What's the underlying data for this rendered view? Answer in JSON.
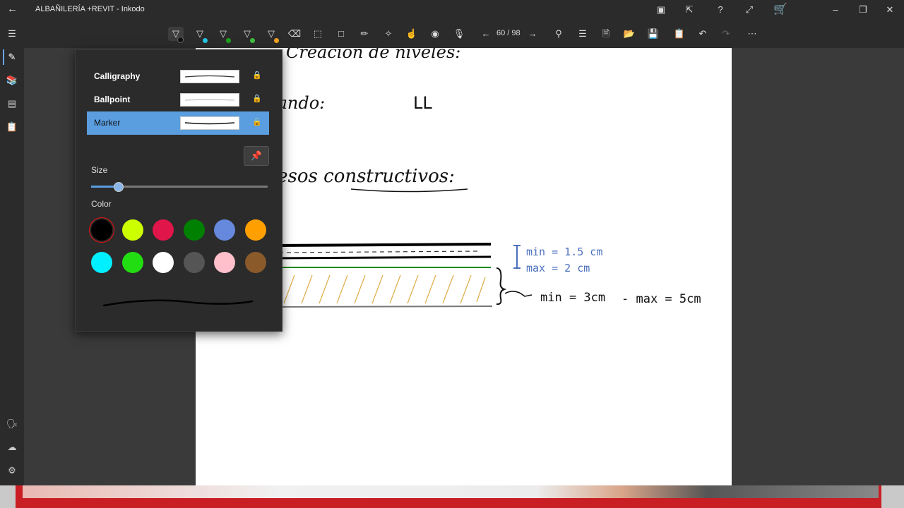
{
  "app": {
    "title": "ALBAÑILERÍA +REVIT - Inkodo"
  },
  "titlebar": {
    "icons": [
      "back-arrow-icon",
      "share-icon",
      "export-icon",
      "help-icon",
      "fullscreen-icon",
      "cart-icon",
      "minimize-icon",
      "restore-icon",
      "close-icon"
    ]
  },
  "toolbar": {
    "pens": [
      {
        "name": "pen-black",
        "color": "#111111"
      },
      {
        "name": "pen-cyan",
        "color": "#27c3e0"
      },
      {
        "name": "pen-green",
        "color": "#1ea21e"
      },
      {
        "name": "pen-lime",
        "color": "#3fbe3f"
      },
      {
        "name": "pen-orange",
        "color": "#f0a020"
      }
    ],
    "page_counter": "60 / 98"
  },
  "sidebar": {
    "items": [
      "pen-icon",
      "library-icon",
      "slides-icon",
      "clipboard-icon",
      "presenter-icon",
      "cloud-icon",
      "settings-icon"
    ]
  },
  "pen_panel": {
    "pen_types": [
      {
        "label": "Calligraphy",
        "selected": false
      },
      {
        "label": "Ballpoint",
        "selected": false
      },
      {
        "label": "Marker",
        "selected": true
      }
    ],
    "size_label": "Size",
    "size_value": 0.15,
    "color_label": "Color",
    "colors": [
      "#000000",
      "#ccff00",
      "#e0164a",
      "#008000",
      "#6688dd",
      "#ffa000",
      "#00f0ff",
      "#22dd11",
      "#ffffff",
      "#555555",
      "#ffc0cb",
      "#8b5a2b"
    ],
    "selected_color": "#000000"
  },
  "note": {
    "line1": "Creación de niveles:",
    "line2": "Comando:",
    "line2_value": "LL",
    "line3": "Procesos constructivos:",
    "ann1a": "min = 1.5 cm",
    "ann1b": "max = 2 cm",
    "ann2": "min = 3cm",
    "ann3": "- max = 5cm"
  }
}
